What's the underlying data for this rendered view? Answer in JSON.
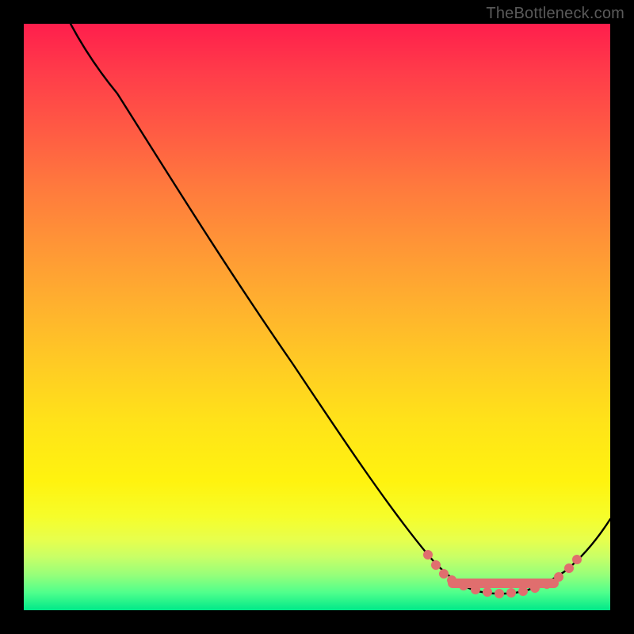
{
  "watermark": "TheBottleneck.com",
  "colors": {
    "frame": "#000000",
    "curve": "#000000",
    "marker": "#e06e6e",
    "gradient_top": "#ff1e4c",
    "gradient_bottom": "#00e989"
  },
  "chart_data": {
    "type": "line",
    "title": "",
    "xlabel": "",
    "ylabel": "",
    "x_range": [
      0,
      100
    ],
    "y_range": [
      0,
      100
    ],
    "series": [
      {
        "name": "bottleneck-curve",
        "x": [
          8,
          12,
          16,
          20,
          25,
          30,
          35,
          40,
          45,
          50,
          55,
          60,
          65,
          70,
          72,
          74,
          76,
          78,
          80,
          82,
          84,
          86,
          88,
          90,
          92,
          94,
          96,
          98,
          100
        ],
        "y": [
          100,
          97,
          93,
          88,
          81,
          73,
          66,
          58,
          51,
          43,
          36,
          28,
          21,
          13,
          10,
          8,
          6,
          5,
          4,
          3.5,
          3.2,
          3.1,
          3.3,
          4,
          6,
          9,
          13,
          18,
          24
        ]
      }
    ],
    "markers": {
      "name": "highlighted-segment",
      "x": [
        70,
        72,
        74,
        76,
        78,
        80,
        82,
        84,
        86,
        88,
        90,
        92,
        94
      ],
      "y": [
        13,
        10,
        8,
        6,
        5,
        4,
        3.5,
        3.2,
        3.1,
        3.3,
        4,
        6,
        9
      ]
    }
  }
}
